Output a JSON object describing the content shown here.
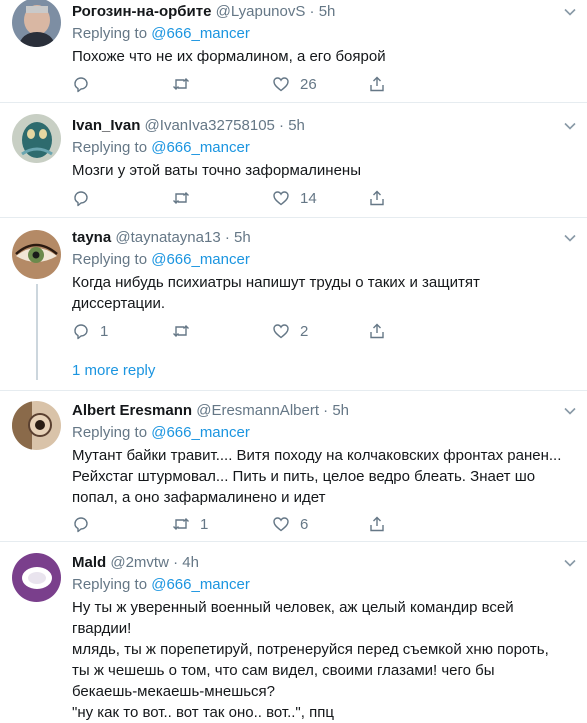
{
  "tweets": [
    {
      "name": "Рогозин-на-орбите",
      "handle": "@LyapunovS",
      "dot": "·",
      "time": "5h",
      "replying_prefix": "Replying to",
      "replying_to": "@666_mancer",
      "text": [
        "Похоже что не их формалином, а его боярой"
      ],
      "replies": "",
      "retweets": "",
      "likes": "26"
    },
    {
      "name": "Ivan_Ivan",
      "handle": "@IvanIva32758105",
      "dot": "·",
      "time": "5h",
      "replying_prefix": "Replying to",
      "replying_to": "@666_mancer",
      "text": [
        "Мозги у этой ваты точно заформалинены"
      ],
      "replies": "",
      "retweets": "",
      "likes": "14"
    },
    {
      "name": "tayna",
      "handle": "@taynatayna13",
      "dot": "·",
      "time": "5h",
      "replying_prefix": "Replying to",
      "replying_to": "@666_mancer",
      "text": [
        "Когда нибудь психиатры напишут труды о таких и защитят",
        "диссертации."
      ],
      "replies": "1",
      "retweets": "",
      "likes": "2",
      "more_replies": "1 more reply"
    },
    {
      "name": "Albert Eresmann",
      "handle": "@EresmannAlbert",
      "dot": "·",
      "time": "5h",
      "replying_prefix": "Replying to",
      "replying_to": "@666_mancer",
      "text": [
        "Мутант байки травит.... Витя походу на колчаковских фронтах ранен...",
        "Рейхстаг штурмовал... Пить и пить, целое ведро блеать. Знает шо",
        "попал, а оно зафармалинено и идет"
      ],
      "replies": "",
      "retweets": "1",
      "likes": "6"
    },
    {
      "name": "Mald",
      "handle": "@2mvtw",
      "dot": "·",
      "time": "4h",
      "replying_prefix": "Replying to",
      "replying_to": "@666_mancer",
      "text": [
        "Ну ты ж уверенный военный человек, аж целый командир всей",
        "гвардии!",
        "млядь, ты ж порепетируй, потренеруйся перед съемкой хню пороть,",
        "ты ж чешешь о том, что сам видел, своими глазами! чего бы",
        "бекаешь-мекаешь-мнешься?",
        "\"ну как то вот.. вот так оно.. вот..\", ппц"
      ],
      "replies": "",
      "retweets": "",
      "likes": ""
    }
  ],
  "icons": {
    "reply": "reply-icon",
    "retweet": "retweet-icon",
    "like": "like-icon",
    "share": "share-icon",
    "more": "chevron-down-icon"
  },
  "colors": {
    "link": "#1b95e0",
    "secondary": "#657786",
    "divider": "#e6ecf0"
  }
}
